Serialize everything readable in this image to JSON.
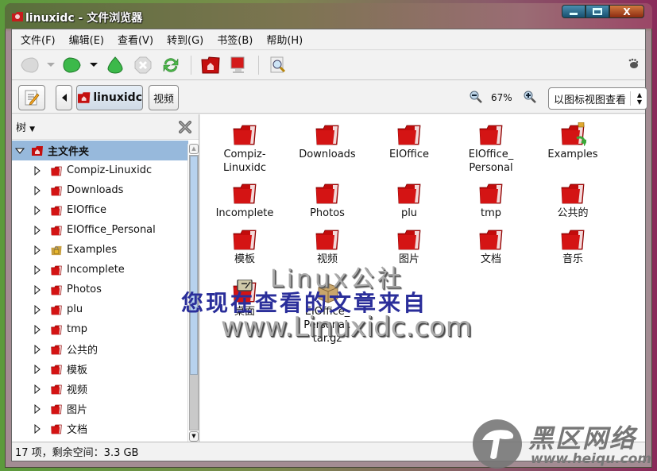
{
  "window": {
    "title": "linuxidc - 文件浏览器",
    "buttons": {
      "minimize": "minimize",
      "maximize": "maximize",
      "close": "X"
    }
  },
  "menubar": {
    "items": [
      {
        "label": "文件(F)"
      },
      {
        "label": "编辑(E)"
      },
      {
        "label": "查看(V)"
      },
      {
        "label": "转到(G)"
      },
      {
        "label": "书签(B)"
      },
      {
        "label": "帮助(H)"
      }
    ]
  },
  "toolbar": {
    "buttons": [
      {
        "name": "back",
        "icon": "back-arrow-icon",
        "enabled": false
      },
      {
        "name": "forward",
        "icon": "forward-arrow-icon",
        "enabled": true
      },
      {
        "name": "up",
        "icon": "up-arrow-icon",
        "enabled": true
      },
      {
        "name": "stop",
        "icon": "stop-icon",
        "enabled": false
      },
      {
        "name": "reload",
        "icon": "reload-icon",
        "enabled": true
      },
      {
        "name": "home",
        "icon": "home-folder-icon",
        "enabled": true
      },
      {
        "name": "computer",
        "icon": "computer-icon",
        "enabled": true
      },
      {
        "name": "search",
        "icon": "search-icon",
        "enabled": true
      }
    ],
    "throbber_icon": "gnome-foot-icon"
  },
  "locationbar": {
    "breadcrumbs": [
      {
        "label": "linuxidc",
        "active": true
      },
      {
        "label": "视频",
        "active": false
      }
    ],
    "zoom_level": "67%",
    "view_mode": "以图标视图查看"
  },
  "sidepane": {
    "title": "树",
    "root": {
      "label": "主文件夹",
      "expanded": true
    },
    "items": [
      {
        "label": "Compiz-Linuxidc",
        "icon": "folder"
      },
      {
        "label": "Downloads",
        "icon": "folder"
      },
      {
        "label": "EIOffice",
        "icon": "folder"
      },
      {
        "label": "EIOffice_Personal",
        "icon": "folder"
      },
      {
        "label": "Examples",
        "icon": "locked-folder"
      },
      {
        "label": "Incomplete",
        "icon": "folder"
      },
      {
        "label": "Photos",
        "icon": "folder"
      },
      {
        "label": "plu",
        "icon": "folder"
      },
      {
        "label": "tmp",
        "icon": "folder"
      },
      {
        "label": "公共的",
        "icon": "folder"
      },
      {
        "label": "模板",
        "icon": "folder"
      },
      {
        "label": "视频",
        "icon": "folder"
      },
      {
        "label": "图片",
        "icon": "folder"
      },
      {
        "label": "文档",
        "icon": "folder"
      }
    ],
    "scroll_fraction_visible": 0.8
  },
  "iconview": {
    "items": [
      {
        "label": "Compiz-\nLinuxidc",
        "icon": "folder"
      },
      {
        "label": "Downloads",
        "icon": "folder"
      },
      {
        "label": "EIOffice",
        "icon": "folder"
      },
      {
        "label": "EIOffice_\nPersonal",
        "icon": "folder"
      },
      {
        "label": "Examples",
        "icon": "locked-link-folder"
      },
      {
        "label": "Incomplete",
        "icon": "folder"
      },
      {
        "label": "Photos",
        "icon": "folder"
      },
      {
        "label": "plu",
        "icon": "folder"
      },
      {
        "label": "tmp",
        "icon": "folder"
      },
      {
        "label": "公共的",
        "icon": "folder"
      },
      {
        "label": "模板",
        "icon": "folder"
      },
      {
        "label": "视频",
        "icon": "folder"
      },
      {
        "label": "图片",
        "icon": "folder"
      },
      {
        "label": "文档",
        "icon": "folder"
      },
      {
        "label": "音乐",
        "icon": "folder"
      },
      {
        "label": "桌面",
        "icon": "desktop-folder"
      },
      {
        "label": "EIOffice_\nPersonal.\ntar.gz",
        "icon": "archive"
      }
    ]
  },
  "statusbar": {
    "text": "17 项，剩余空间：3.3 GB"
  },
  "watermarks": {
    "line1": "Linux公社",
    "line2": "您现在查看的文章来自",
    "line3": "www.Linuxidc.com",
    "logo_text": "黑区网络",
    "logo_url": "www.heiqu.com"
  },
  "colors": {
    "folder_red": "#cc0000",
    "selection_blue": "#97b9dc",
    "watermark_blue": "#2a2e9a"
  }
}
